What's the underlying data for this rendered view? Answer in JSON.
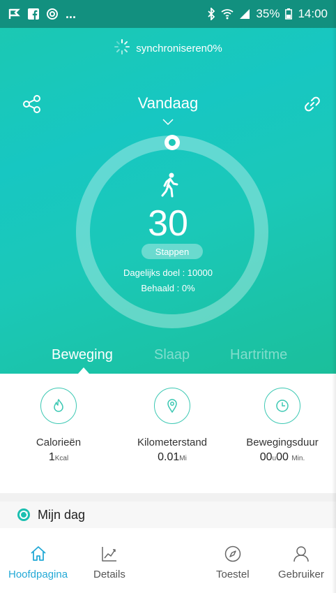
{
  "status_bar": {
    "left_icons": [
      "flag-icon",
      "facebook-icon",
      "app-icon"
    ],
    "more": "...",
    "bluetooth": "bluetooth-icon",
    "wifi": "wifi-icon",
    "signal": "signal-icon",
    "battery": "35%",
    "time": "14:00"
  },
  "sync": {
    "label": "synchroniseren0%"
  },
  "header": {
    "title": "Vandaag"
  },
  "activity": {
    "steps": "30",
    "steps_label": "Stappen",
    "goal": "Dagelijks doel : 10000",
    "achieved": "Behaald : 0%",
    "progress_fraction": 0.0
  },
  "tabs": [
    {
      "label": "Beweging",
      "active": true
    },
    {
      "label": "Slaap",
      "active": false
    },
    {
      "label": "Hartritme",
      "active": false
    }
  ],
  "stats": [
    {
      "label": "Calorieën",
      "value": "1",
      "unit": "Kcal",
      "icon": "flame-icon"
    },
    {
      "label": "Kilometerstand",
      "value": "0.01",
      "unit": "Mi",
      "icon": "location-pin-icon"
    },
    {
      "label": "Bewegingsduur",
      "value_hours": "00",
      "hour_unit": "u",
      "value_minutes": "00",
      "minute_unit": "Min.",
      "icon": "clock-icon"
    }
  ],
  "my_day": {
    "label": "Mijn dag"
  },
  "bottom_nav": [
    {
      "label": "Hoofdpagina",
      "icon": "home-icon",
      "active": true
    },
    {
      "label": "Details",
      "icon": "chart-icon",
      "active": false
    },
    {
      "label": "Toestel",
      "icon": "compass-icon",
      "active": false
    },
    {
      "label": "Gebruiker",
      "icon": "user-icon",
      "active": false
    }
  ],
  "colors": {
    "accent_teal": "#1bc8b8",
    "status_bar": "#12907f",
    "nav_active": "#23a9d6",
    "icon_outline": "#3cc8b3"
  }
}
